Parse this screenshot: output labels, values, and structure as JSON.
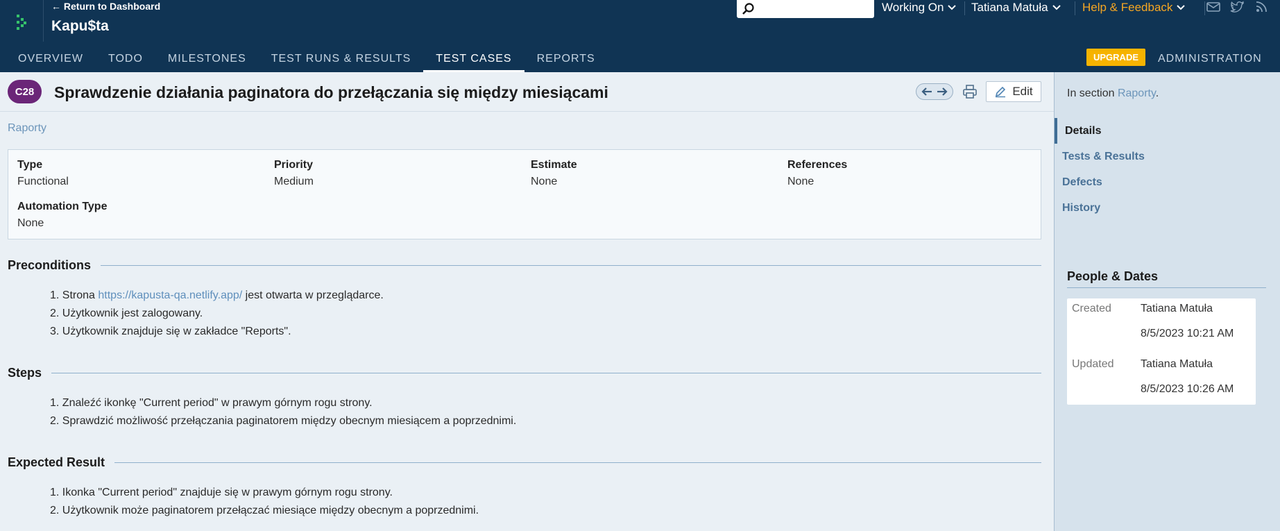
{
  "header": {
    "return_link": "← Return to Dashboard",
    "project_name": "Kapu$ta",
    "search_placeholder": "",
    "working_on": "Working On",
    "user_name": "Tatiana Matuła",
    "help": "Help & Feedback",
    "icons": [
      "mail-icon",
      "twitter-icon",
      "rss-icon"
    ]
  },
  "nav": {
    "tabs": [
      {
        "label": "OVERVIEW"
      },
      {
        "label": "TODO"
      },
      {
        "label": "MILESTONES"
      },
      {
        "label": "TEST RUNS & RESULTS"
      },
      {
        "label": "TEST CASES",
        "active": true
      },
      {
        "label": "REPORTS"
      }
    ],
    "upgrade": "UPGRADE",
    "administration": "ADMINISTRATION"
  },
  "case": {
    "id": "C28",
    "title": "Sprawdzenie działania paginatora do przełączania się między miesiącami",
    "edit_label": "Edit",
    "section": "Raporty"
  },
  "fields": {
    "type_label": "Type",
    "type_value": "Functional",
    "priority_label": "Priority",
    "priority_value": "Medium",
    "estimate_label": "Estimate",
    "estimate_value": "None",
    "references_label": "References",
    "references_value": "None",
    "automation_label": "Automation Type",
    "automation_value": "None"
  },
  "preconditions": {
    "heading": "Preconditions",
    "item1_prefix": "1. Strona ",
    "item1_link": "https://kapusta-qa.netlify.app/",
    "item1_suffix": " jest otwarta w przeglądarce.",
    "item2": "2. Użytkownik jest zalogowany.",
    "item3": "3. Użytkownik znajduje się w zakładce \"Reports\"."
  },
  "steps": {
    "heading": "Steps",
    "item1": "1. Znaleźć ikonkę \"Current period\" w prawym górnym rogu strony.",
    "item2": "2. Sprawdzić możliwość przełączania paginatorem między obecnym miesiącem a poprzednimi."
  },
  "expected": {
    "heading": "Expected Result",
    "item1": "1. Ikonka \"Current period\" znajduje się w prawym górnym rogu strony.",
    "item2": "2. Użytkownik może paginatorem przełączać miesiące między obecnym a poprzednimi."
  },
  "sidebar": {
    "in_section_prefix": "In section ",
    "in_section_link": "Raporty",
    "in_section_suffix": ".",
    "items": [
      "Details",
      "Tests & Results",
      "Defects",
      "History"
    ],
    "people_heading": "People & Dates",
    "created_label": "Created",
    "created_by": "Tatiana Matuła",
    "created_date": "8/5/2023 10:21 AM",
    "updated_label": "Updated",
    "updated_by": "Tatiana Matuła",
    "updated_date": "8/5/2023 10:26 AM"
  },
  "colors": {
    "header_bg": "#103454",
    "badge": "#6b2678",
    "upgrade": "#f6b300",
    "help": "#f5a623",
    "link": "#6c95ba"
  }
}
